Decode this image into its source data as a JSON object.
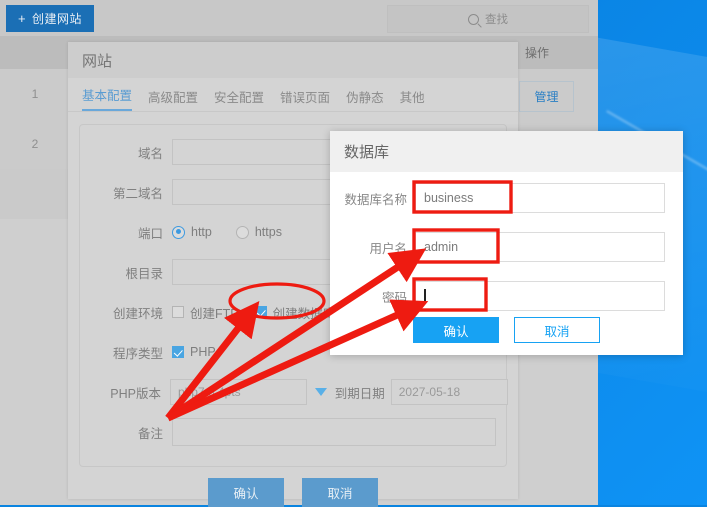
{
  "toolbar": {
    "create_site_label": "创建网站",
    "plus_icon": "plus-icon",
    "search_placeholder": "查找",
    "search_icon": "search-icon"
  },
  "table": {
    "header_index": "",
    "header_action": "操作",
    "rows": [
      {
        "index": "1",
        "action_label": "管理"
      },
      {
        "index": "2",
        "action_label": ""
      },
      {
        "index": "",
        "action_label": ""
      }
    ],
    "manage_label": "管理"
  },
  "site_panel": {
    "title": "网站",
    "tabs": [
      {
        "label": "基本配置",
        "active": true
      },
      {
        "label": "高级配置",
        "active": false
      },
      {
        "label": "安全配置",
        "active": false
      },
      {
        "label": "错误页面",
        "active": false
      },
      {
        "label": "伪静态",
        "active": false
      },
      {
        "label": "其他",
        "active": false
      }
    ],
    "fields": {
      "domain_label": "域名",
      "domain_value": "",
      "second_domain_label": "第二域名",
      "second_domain_value": "",
      "port_label": "端口",
      "port_http": "http",
      "port_https": "https",
      "root_label": "根目录",
      "root_value": "",
      "env_label": "创建环境",
      "env_ftp": "创建FTP",
      "env_db": "创建数据库",
      "program_label": "程序类型",
      "program_php": "PHP",
      "php_version_label": "PHP版本",
      "php_version_value": "php7.3.4pts",
      "expire_label": "到期日期",
      "expire_value": "2027-05-18",
      "remark_label": "备注",
      "remark_value": ""
    },
    "confirm_label": "确认",
    "cancel_label": "取消"
  },
  "db_dialog": {
    "title": "数据库",
    "name_label": "数据库名称",
    "name_value": "business",
    "user_label": "用户名",
    "user_value": "admin",
    "password_label": "密码",
    "password_value": "",
    "confirm_label": "确认",
    "cancel_label": "取消"
  },
  "colors": {
    "accent_blue": "#17a2f3",
    "toolbar_blue": "#1b6fb5",
    "annotation_red": "#ee1b11",
    "desktop_blue": "#0a84e0"
  }
}
